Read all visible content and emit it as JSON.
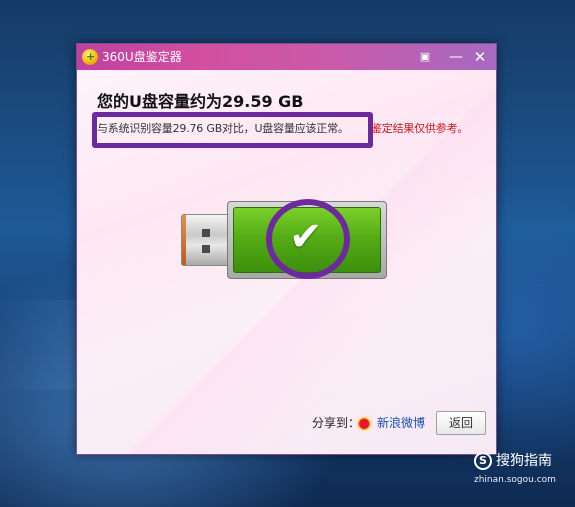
{
  "window": {
    "title": "360U盘鉴定器",
    "icons": {
      "logo": "360-logo-icon",
      "message": "message-icon",
      "minimize": "minimize-icon",
      "close": "close-icon"
    },
    "minimize_glyph": "—",
    "close_glyph": "✕",
    "message_glyph": "▣"
  },
  "result": {
    "capacity_text": "您的U盘容量约为29.59 GB",
    "compare_text": "与系统识别容量29.76 GB对比，U盘容量应该正常。",
    "note_text": "鉴定结果仅供参考。",
    "status": "check-mark-icon",
    "check_glyph": "✔"
  },
  "footer": {
    "share_label": "分享到：",
    "weibo_label": "新浪微博",
    "back_label": "返回"
  },
  "watermark": {
    "logo_glyph": "S",
    "brand_text": "搜狗指南",
    "url_text": "zhinan.sogou.com"
  },
  "colors": {
    "titlebar": "#c13fa0",
    "highlight": "#6d2a9e",
    "note_red": "#d4141e",
    "usb_green": "#55ad16",
    "link_blue": "#1a4fb0"
  }
}
